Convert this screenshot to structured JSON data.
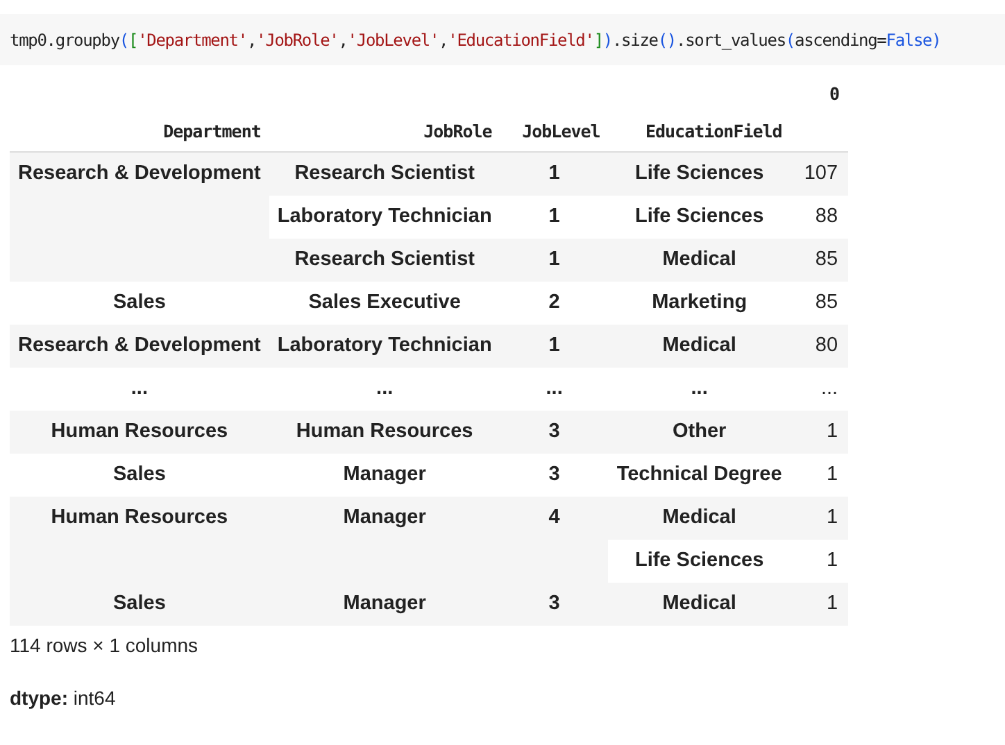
{
  "code": [
    {
      "kind": "plain",
      "text": "tmp0.groupby"
    },
    {
      "kind": "paren",
      "text": "("
    },
    {
      "kind": "bracket",
      "text": "["
    },
    {
      "kind": "string",
      "text": "'Department'"
    },
    {
      "kind": "plain",
      "text": ","
    },
    {
      "kind": "string",
      "text": "'JobRole'"
    },
    {
      "kind": "plain",
      "text": ","
    },
    {
      "kind": "string",
      "text": "'JobLevel'"
    },
    {
      "kind": "plain",
      "text": ","
    },
    {
      "kind": "string",
      "text": "'EducationField'"
    },
    {
      "kind": "bracket",
      "text": "]"
    },
    {
      "kind": "paren",
      "text": ")"
    },
    {
      "kind": "plain",
      "text": ".size"
    },
    {
      "kind": "paren",
      "text": "()"
    },
    {
      "kind": "plain",
      "text": ".sort_values"
    },
    {
      "kind": "paren",
      "text": "("
    },
    {
      "kind": "plain",
      "text": "ascending="
    },
    {
      "kind": "keyword",
      "text": "False"
    },
    {
      "kind": "paren",
      "text": ")"
    }
  ],
  "table": {
    "value_column": "0",
    "index_names": [
      "Department",
      "JobRole",
      "JobLevel",
      "EducationField"
    ],
    "groups": [
      {
        "text": "Research & Development",
        "children": [
          {
            "text": "Research Scientist",
            "children": [
              {
                "text": "1",
                "children": [
                  {
                    "text": "Life Sciences",
                    "value": "107"
                  }
                ]
              }
            ]
          },
          {
            "text": "Laboratory Technician",
            "children": [
              {
                "text": "1",
                "children": [
                  {
                    "text": "Life Sciences",
                    "value": "88"
                  }
                ]
              }
            ]
          },
          {
            "text": "Research Scientist",
            "children": [
              {
                "text": "1",
                "children": [
                  {
                    "text": "Medical",
                    "value": "85"
                  }
                ]
              }
            ]
          }
        ]
      },
      {
        "text": "Sales",
        "children": [
          {
            "text": "Sales Executive",
            "children": [
              {
                "text": "2",
                "children": [
                  {
                    "text": "Marketing",
                    "value": "85"
                  }
                ]
              }
            ]
          }
        ]
      },
      {
        "text": "Research & Development",
        "children": [
          {
            "text": "Laboratory Technician",
            "children": [
              {
                "text": "1",
                "children": [
                  {
                    "text": "Medical",
                    "value": "80"
                  }
                ]
              }
            ]
          }
        ]
      },
      {
        "text": "...",
        "children": [
          {
            "text": "...",
            "children": [
              {
                "text": "...",
                "children": [
                  {
                    "text": "...",
                    "value": "..."
                  }
                ]
              }
            ]
          }
        ]
      },
      {
        "text": "Human Resources",
        "children": [
          {
            "text": "Human Resources",
            "children": [
              {
                "text": "3",
                "children": [
                  {
                    "text": "Other",
                    "value": "1"
                  }
                ]
              }
            ]
          }
        ]
      },
      {
        "text": "Sales",
        "children": [
          {
            "text": "Manager",
            "children": [
              {
                "text": "3",
                "children": [
                  {
                    "text": "Technical Degree",
                    "value": "1"
                  }
                ]
              }
            ]
          }
        ]
      },
      {
        "text": "Human Resources",
        "children": [
          {
            "text": "Manager",
            "children": [
              {
                "text": "4",
                "children": [
                  {
                    "text": "Medical",
                    "value": "1"
                  },
                  {
                    "text": "Life Sciences",
                    "value": "1"
                  }
                ]
              }
            ]
          }
        ]
      },
      {
        "text": "Sales",
        "children": [
          {
            "text": "Manager",
            "children": [
              {
                "text": "3",
                "children": [
                  {
                    "text": "Medical",
                    "value": "1"
                  }
                ]
              }
            ]
          }
        ]
      }
    ]
  },
  "shape": "114 rows × 1 columns",
  "dtype": {
    "label": "dtype:",
    "value": "int64"
  }
}
